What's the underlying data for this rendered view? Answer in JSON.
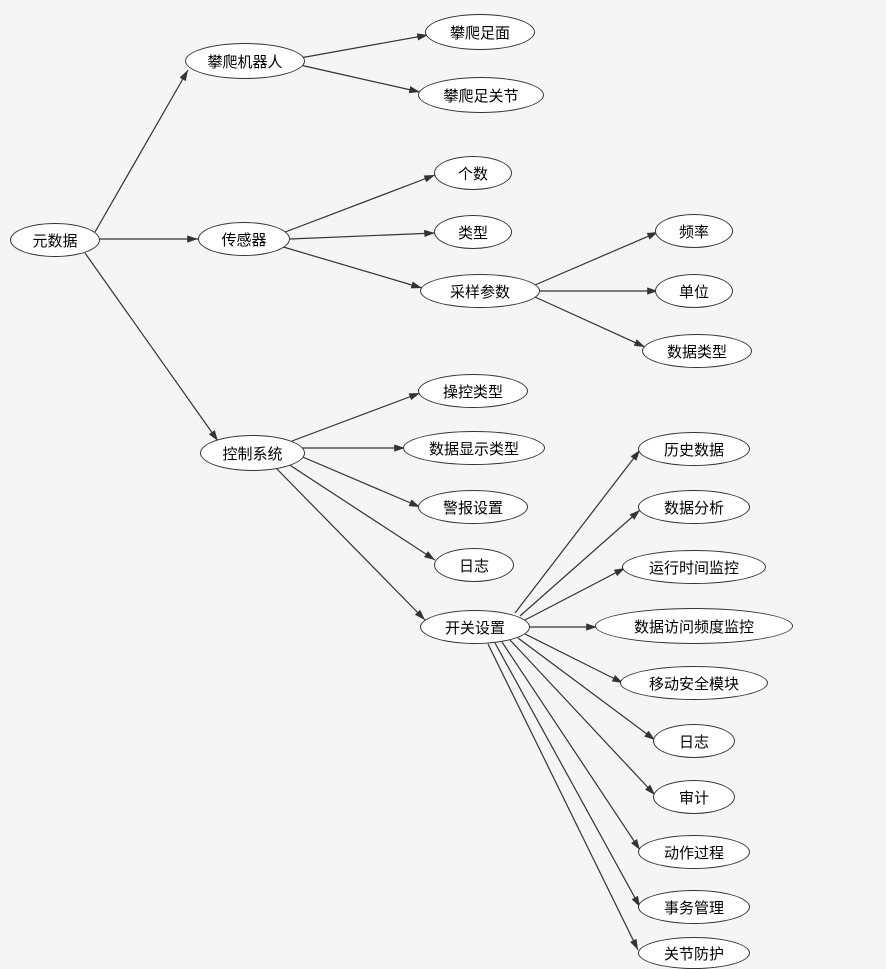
{
  "nodes": {
    "root": "元数据",
    "robot": "攀爬机器人",
    "robot_foot": "攀爬足面",
    "robot_joint": "攀爬足关节",
    "sensor": "传感器",
    "sensor_count": "个数",
    "sensor_type": "类型",
    "sensor_param": "采样参数",
    "param_freq": "频率",
    "param_unit": "单位",
    "param_datatype": "数据类型",
    "control": "控制系统",
    "ctrl_type": "操控类型",
    "ctrl_display": "数据显示类型",
    "ctrl_alarm": "警报设置",
    "ctrl_log": "日志",
    "ctrl_switch": "开关设置",
    "sw_history": "历史数据",
    "sw_analysis": "数据分析",
    "sw_runtime": "运行时间监控",
    "sw_access": "数据访问频度监控",
    "sw_security": "移动安全模块",
    "sw_log": "日志",
    "sw_audit": "审计",
    "sw_action": "动作过程",
    "sw_affair": "事务管理",
    "sw_protect": "关节防护"
  },
  "chart_data": {
    "type": "tree",
    "root": "元数据",
    "children": [
      {
        "name": "攀爬机器人",
        "children": [
          "攀爬足面",
          "攀爬足关节"
        ]
      },
      {
        "name": "传感器",
        "children": [
          "个数",
          "类型",
          {
            "name": "采样参数",
            "children": [
              "频率",
              "单位",
              "数据类型"
            ]
          }
        ]
      },
      {
        "name": "控制系统",
        "children": [
          "操控类型",
          "数据显示类型",
          "警报设置",
          "日志",
          {
            "name": "开关设置",
            "children": [
              "历史数据",
              "数据分析",
              "运行时间监控",
              "数据访问频度监控",
              "移动安全模块",
              "日志",
              "审计",
              "动作过程",
              "事务管理",
              "关节防护"
            ]
          }
        ]
      }
    ]
  }
}
